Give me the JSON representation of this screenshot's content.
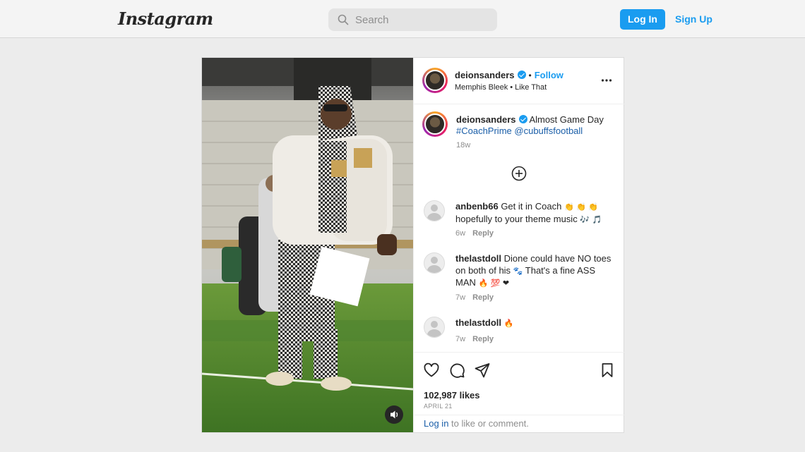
{
  "header": {
    "logo": "Instagram",
    "search_placeholder": "Search",
    "login_label": "Log In",
    "signup_label": "Sign Up"
  },
  "post": {
    "author": {
      "username": "deionsanders",
      "verified": true,
      "follow_label": "Follow",
      "audio": "Memphis Bleek • Like That"
    },
    "caption": {
      "username": "deionsanders",
      "text": "Almost Game Day",
      "hashtag": "#CoachPrime",
      "mention": "@cubuffsfootball",
      "time": "18w"
    },
    "comments": [
      {
        "username": "anbenb66",
        "text": "Get it in Coach",
        "emoji_1": "👏 👏 👏",
        "text_2": "hopefully to your theme music",
        "emoji_2": "🎶 🎵",
        "time": "6w",
        "reply_label": "Reply"
      },
      {
        "username": "thelastdoll",
        "text": "Dione could have NO toes on both of his",
        "emoji_1": "🐾",
        "text_2": "That's a fine ASS MAN",
        "emoji_2": "🔥 💯 ❤",
        "time": "7w",
        "reply_label": "Reply"
      },
      {
        "username": "thelastdoll",
        "text": "",
        "emoji_1": "🔥",
        "time": "7w",
        "reply_label": "Reply"
      }
    ],
    "likes": "102,987 likes",
    "date": "APRIL 21",
    "login_link": "Log in",
    "login_suffix": "to like or comment."
  },
  "colors": {
    "accent": "#1a9cf0",
    "link": "#1a5ea8",
    "background": "#ececec"
  }
}
